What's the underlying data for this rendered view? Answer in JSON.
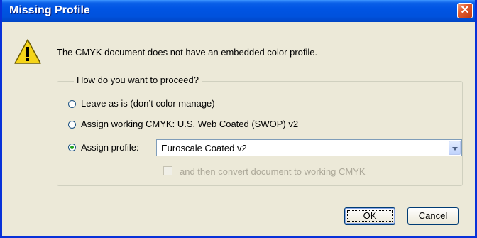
{
  "window": {
    "title": "Missing Profile",
    "close_symbol": "✕"
  },
  "message": "The CMYK document does not have an embedded color profile.",
  "group": {
    "legend": "How do you want to proceed?",
    "options": [
      {
        "label": "Leave as is (don’t color manage)",
        "checked": false
      },
      {
        "label": "Assign working CMYK:  U.S. Web Coated (SWOP) v2",
        "checked": false
      },
      {
        "label": "Assign profile:",
        "checked": true
      }
    ],
    "profile_select": {
      "value": "Euroscale Coated v2"
    },
    "convert_checkbox": {
      "label": "and then convert document to working CMYK",
      "checked": false,
      "enabled": false
    }
  },
  "buttons": {
    "ok": "OK",
    "cancel": "Cancel"
  },
  "icons": {
    "warning": "warning-icon",
    "close": "close-icon",
    "dropdown": "chevron-down-icon"
  },
  "colors": {
    "titlebar": "#0054e3",
    "dialog_bg": "#ece9d8",
    "warning_yellow": "#f5d418"
  }
}
